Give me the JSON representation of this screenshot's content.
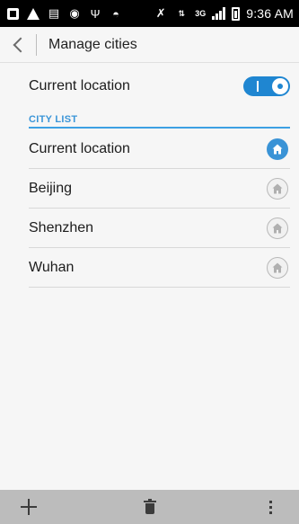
{
  "status_bar": {
    "time": "9:36 AM",
    "network": "3G",
    "left_icons": [
      "notification-square-icon",
      "warning-icon",
      "document-icon",
      "app-icon",
      "usb-icon",
      "android-icon"
    ],
    "right_icons": [
      "mute-icon",
      "data-arrows-icon",
      "signal-icon",
      "battery-icon"
    ]
  },
  "header": {
    "title": "Manage cities",
    "back_icon": "back-chevron-icon"
  },
  "current_location_setting": {
    "label": "Current location",
    "enabled": true,
    "toggle_color": "#1f86d1"
  },
  "city_list": {
    "section_label": "CITY LIST",
    "accent_color": "#3a95d8",
    "items": [
      {
        "name": "Current location",
        "is_home": true
      },
      {
        "name": "Beijing",
        "is_home": false
      },
      {
        "name": "Shenzhen",
        "is_home": false
      },
      {
        "name": "Wuhan",
        "is_home": false
      }
    ]
  },
  "bottom_bar": {
    "icons": [
      "add-icon",
      "delete-icon",
      "overflow-menu-icon"
    ]
  }
}
